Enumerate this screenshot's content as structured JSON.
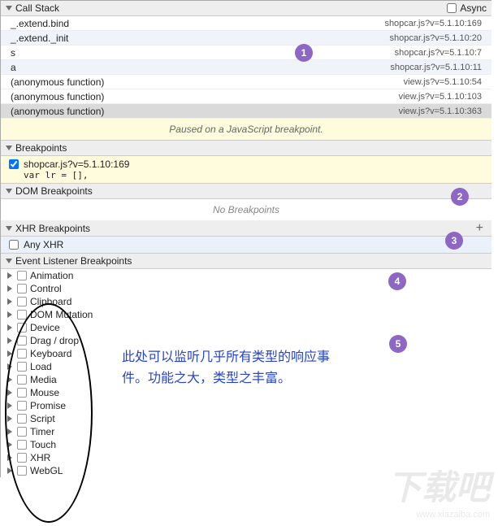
{
  "callstack": {
    "title": "Call Stack",
    "async_label": "Async",
    "frames": [
      {
        "fn": "_.extend.bind",
        "loc": "shopcar.js?v=5.1.10:169",
        "alt": false
      },
      {
        "fn": "_.extend._init",
        "loc": "shopcar.js?v=5.1.10:20",
        "alt": true
      },
      {
        "fn": "s",
        "loc": "shopcar.js?v=5.1.10:7",
        "alt": false
      },
      {
        "fn": "a",
        "loc": "shopcar.js?v=5.1.10:11",
        "alt": true
      },
      {
        "fn": "(anonymous function)",
        "loc": "view.js?v=5.1.10:54",
        "alt": false
      },
      {
        "fn": "(anonymous function)",
        "loc": "view.js?v=5.1.10:103",
        "alt": false
      },
      {
        "fn": "(anonymous function)",
        "loc": "view.js?v=5.1.10:363",
        "alt": false,
        "sel": true
      }
    ],
    "paused_msg": "Paused on a JavaScript breakpoint."
  },
  "breakpoints": {
    "title": "Breakpoints",
    "items": [
      {
        "label": "shopcar.js?v=5.1.10:169",
        "code": "var lr = [],"
      }
    ]
  },
  "dom_bp": {
    "title": "DOM Breakpoints",
    "empty": "No Breakpoints"
  },
  "xhr_bp": {
    "title": "XHR Breakpoints",
    "any": "Any XHR",
    "plus": "+"
  },
  "event_bp": {
    "title": "Event Listener Breakpoints",
    "cats": [
      "Animation",
      "Control",
      "Clipboard",
      "DOM Mutation",
      "Device",
      "Drag / drop",
      "Keyboard",
      "Load",
      "Media",
      "Mouse",
      "Promise",
      "Script",
      "Timer",
      "Touch",
      "XHR",
      "WebGL"
    ]
  },
  "annotation": "此处可以监听几乎所有类型的响应事件。功能之大，类型之丰富。",
  "badges": {
    "b1": "1",
    "b2": "2",
    "b3": "3",
    "b4": "4",
    "b5": "5"
  },
  "watermark": {
    "big": "下载吧",
    "url": "www.xiazaiba.com"
  }
}
